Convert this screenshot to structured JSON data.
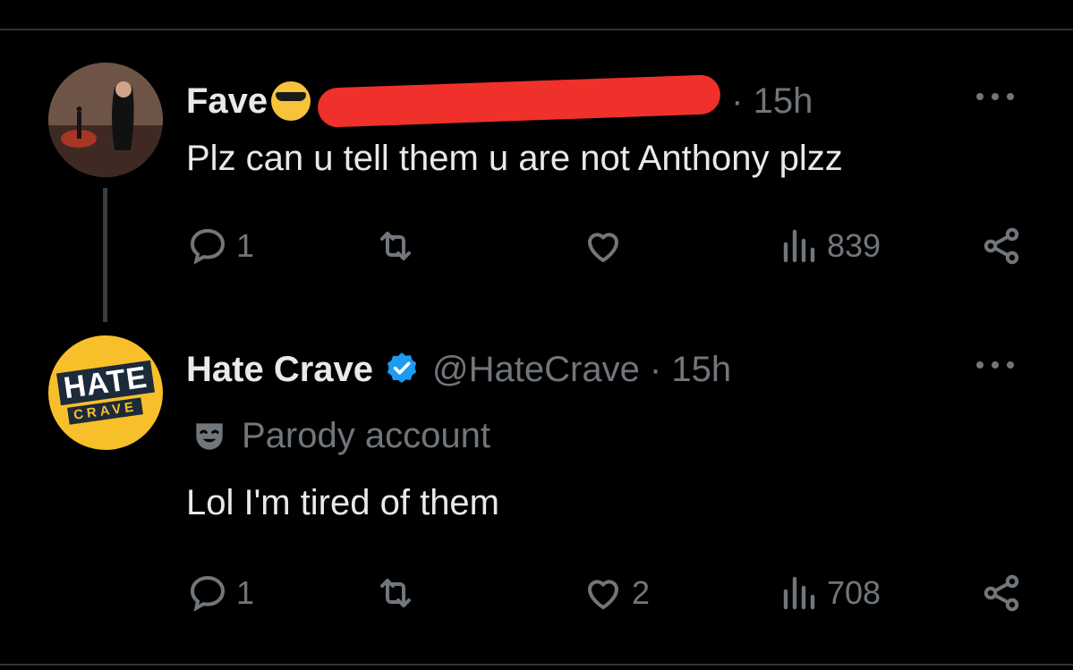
{
  "tweets": [
    {
      "display_name": "Fave",
      "name_emoji": "smiling-face-with-sunglasses",
      "handle_redacted": true,
      "time": "· 15h",
      "text": "Plz can u tell them u are not Anthony plzz",
      "replies": "1",
      "retweets": "",
      "likes": "",
      "views": "839"
    },
    {
      "display_name": "Hate Crave",
      "verified": true,
      "handle": "@HateCrave · 15h",
      "label": "Parody account",
      "text": "Lol I'm tired of them",
      "replies": "1",
      "retweets": "",
      "likes": "2",
      "views": "708",
      "avatar_logo": {
        "word": "HATE",
        "sub": "CRAVE"
      }
    }
  ],
  "colors": {
    "background": "#000000",
    "text": "#e7e9ea",
    "muted": "#71767b",
    "verified": "#1d9bf0",
    "redaction": "#f0302a",
    "logo_yellow": "#f7c02a"
  },
  "icons": [
    "reply-icon",
    "retweet-icon",
    "like-icon",
    "views-icon",
    "share-icon",
    "more-icon",
    "verified-icon",
    "parody-mask-icon"
  ]
}
